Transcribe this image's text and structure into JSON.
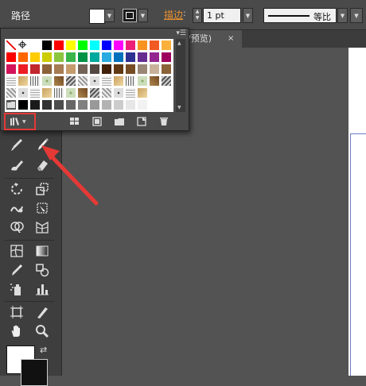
{
  "control_bar": {
    "path_label": "路径",
    "stroke_label": "描边",
    "stroke_weight": "1 pt",
    "stroke_profile": "等比",
    "fill_color": "#ffffff",
    "stroke_color": "#111111"
  },
  "document_tab": {
    "title": "/预览)",
    "close": "×"
  },
  "swatches_panel": {
    "menu_icon": "panel-menu-icon",
    "rows": [
      [
        "none",
        "registration",
        "#ffffff",
        "#000000",
        "#ff0000",
        "#ffff00",
        "#00ff00",
        "#00ffff",
        "#0000ff",
        "#ff00ff",
        "#ed1e79",
        "#f7931e",
        "#f15a24",
        "#fbb03b"
      ],
      [
        "#ff0000",
        "#ff6600",
        "#ffcc00",
        "#cccc00",
        "#8cc63f",
        "#39b54a",
        "#009245",
        "#00a99d",
        "#29abe2",
        "#0071bc",
        "#2e3192",
        "#662d91",
        "#93278f",
        "#9e005d"
      ],
      [
        "#d4145a",
        "#ed1c24",
        "#c1272d",
        "#8c6239",
        "#a67c52",
        "#c69c6d",
        "#736357",
        "#534741",
        "#42210b",
        "#603813",
        "#754c24",
        "#998675",
        "#c7b299",
        "#8c6239"
      ],
      [
        "pattern",
        "pattern",
        "pattern",
        "pattern",
        "pattern",
        "pattern",
        "pattern",
        "pattern",
        "pattern",
        "pattern",
        "pattern",
        "pattern",
        "pattern",
        "pattern"
      ],
      [
        "pattern",
        "pattern",
        "pattern",
        "pattern",
        "pattern",
        "pattern",
        "pattern",
        "pattern",
        "pattern",
        "pattern",
        "pattern",
        "pattern",
        "#ffffff",
        "#ffffff"
      ],
      [
        "folder",
        "#000000",
        "#1a1a1a",
        "#333333",
        "#4d4d4d",
        "#666666",
        "#808080",
        "#999999",
        "#b3b3b3",
        "#cccccc",
        "#e6e6e6",
        "#f2f2f2",
        "#ffffff",
        "#ffffff"
      ]
    ],
    "bottom_icons": [
      "swatch-libraries-menu-icon",
      "show-swatch-kinds-icon",
      "swatch-options-icon",
      "new-color-group-icon",
      "new-swatch-icon",
      "delete-swatch-icon"
    ]
  },
  "toolbar": {
    "tools": [
      "paintbrush-tool-icon",
      "blob-brush-tool-icon",
      "eraser-tool-icon",
      "pencil-tool-icon",
      "rotate-tool-icon",
      "scale-tool-icon",
      "warp-tool-icon",
      "free-transform-tool-icon",
      "shape-builder-tool-icon",
      "perspective-grid-tool-icon",
      "mesh-tool-icon",
      "gradient-tool-icon",
      "eyedropper-tool-icon",
      "blend-tool-icon",
      "symbol-sprayer-tool-icon",
      "column-graph-tool-icon",
      "artboard-tool-icon",
      "slice-tool-icon",
      "hand-tool-icon",
      "zoom-tool-icon"
    ],
    "fill_color": "#ffffff",
    "stroke_color": "#111111"
  },
  "annotation": {
    "highlight_color": "#e53935"
  }
}
